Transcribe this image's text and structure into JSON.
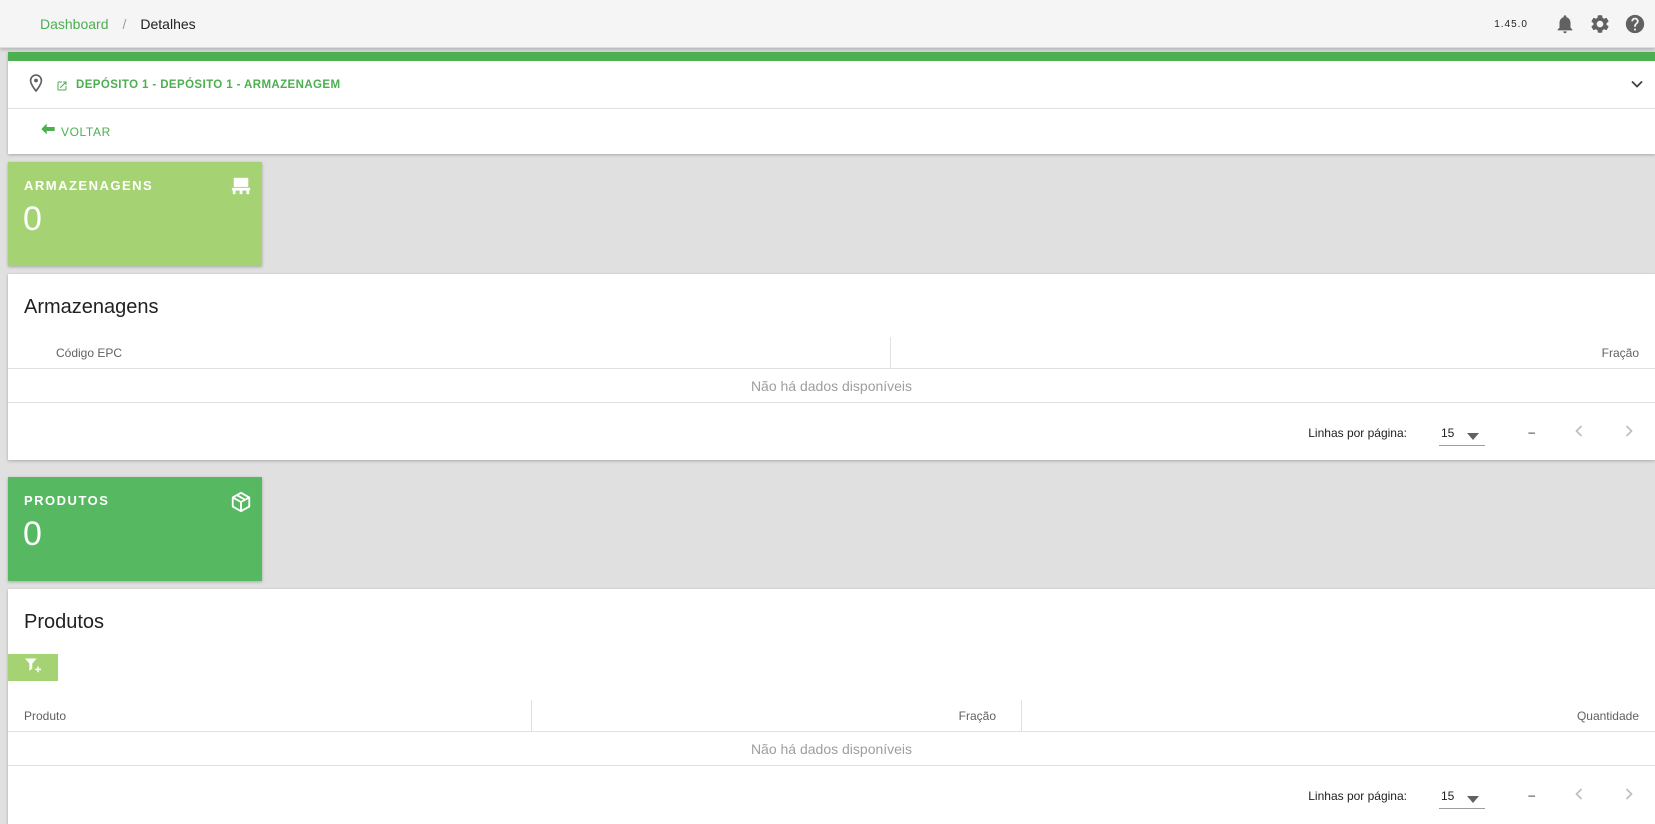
{
  "breadcrumb": {
    "home": "Dashboard",
    "separator": "/",
    "current": "Detalhes"
  },
  "topbar": {
    "version": "1.45.0",
    "icons": [
      "bell-icon",
      "gear-icon",
      "help-icon"
    ]
  },
  "header": {
    "location": "DEPÓSITO 1 - DEPÓSITO 1 - ARMAZENAGEM",
    "back_label": "VOLTAR"
  },
  "armazenagens": {
    "stat_title": "ARMAZENAGENS",
    "stat_value": "0",
    "table_title": "Armazenagens",
    "columns": [
      "Código EPC",
      "Fração"
    ],
    "empty_text": "Não há dados disponíveis",
    "rows_per_page_label": "Linhas por página:",
    "rows_per_page": "15",
    "range": "–"
  },
  "produtos": {
    "stat_title": "PRODUTOS",
    "stat_value": "0",
    "table_title": "Produtos",
    "columns": [
      "Produto",
      "Fração",
      "Quantidade"
    ],
    "empty_text": "Não há dados disponíveis",
    "rows_per_page_label": "Linhas por página:",
    "rows_per_page": "15",
    "range": "–"
  },
  "colors": {
    "accent": "#4caf50",
    "stat_light": "#a5d374",
    "stat_dark": "#57b862",
    "background": "#e0e0e0"
  }
}
